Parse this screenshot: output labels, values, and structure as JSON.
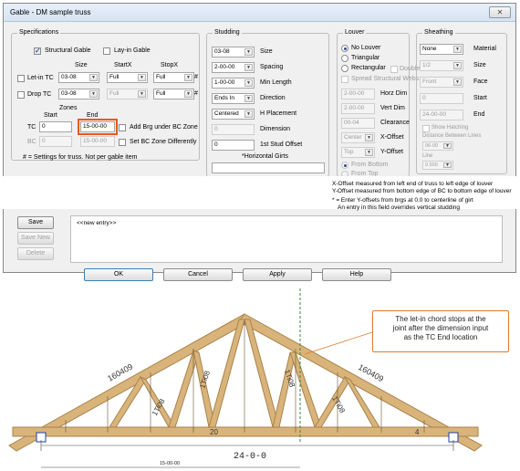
{
  "dialog": {
    "title": "Gable - DM sample truss",
    "close": "✕"
  },
  "specs": {
    "group": "Specifications",
    "structural_gable": "Structural Gable",
    "lay_in_gable": "Lay-in Gable",
    "col_size": "Size",
    "col_startx": "StartX",
    "col_stopx": "StopX",
    "letin_tc": "Let-in TC",
    "letin_size": "03-08",
    "letin_startx": "Full",
    "letin_stopx": "Full",
    "drop_tc": "Drop TC",
    "drop_size": "03-08",
    "drop_startx": "Full",
    "drop_stopx": "Full",
    "hash": "#",
    "zones": "Zones",
    "zones_start": "Start",
    "zones_end": "End",
    "tc": "TC",
    "tc_start": "0",
    "tc_end": "15-00-00",
    "bc": "BC",
    "bc_start": "0",
    "bc_end": "15-00-00",
    "add_brg": "Add Brg under BC Zone",
    "set_bc": "Set BC Zone Differently",
    "note": "# = Settings for truss.  Not per gable item"
  },
  "studding": {
    "group": "Studding",
    "size_val": "03-08",
    "size_lbl": "Size",
    "spacing_val": "2-00-00",
    "spacing_lbl": "Spacing",
    "minlen_val": "1-00-00",
    "minlen_lbl": "Min Length",
    "dir_val": "Ends In",
    "dir_lbl": "Direction",
    "hplace_val": "Centered",
    "hplace_lbl": "H Placement",
    "dim_val": "0",
    "dim_lbl": "Dimension",
    "first_val": "0",
    "first_lbl": "1st Stud Offset",
    "girts_lbl": "*Horizontal Girts",
    "girts_val": ""
  },
  "louver": {
    "group": "Louver",
    "no": "No Louver",
    "tri": "Triangular",
    "rect": "Rectangular",
    "double": "Double",
    "spread": "Spread Structural Webs",
    "horz_val": "2-00-00",
    "horz_lbl": "Horz Dim",
    "vert_val": "2-00-00",
    "vert_lbl": "Vert Dim",
    "clear_val": "00-04",
    "clear_lbl": "Clearance",
    "xoff_val": "Center",
    "xoff_lbl": "X-Offset",
    "yoff_val": "Top",
    "yoff_lbl": "Y-Offset",
    "from_bottom": "From Bottom",
    "from_top": "From Top"
  },
  "sheathing": {
    "group": "Sheathing",
    "mat_val": "None",
    "mat_lbl": "Material",
    "size_val": "1/2",
    "size_lbl": "Size",
    "face_val": "Front",
    "face_lbl": "Face",
    "start_val": "0",
    "start_lbl": "Start",
    "end_val": "24-00-00",
    "end_lbl": "End",
    "show_hatch": "Show Hatching",
    "dist_lbl": "Distance Between Lines",
    "dist_val": "06-00",
    "line_lbl": "Line",
    "line_val": "0.500"
  },
  "notes": {
    "x_off": "X-Offset measured from left end of truss to left edge of louver",
    "y_off": "Y-Offset measured from bottom edge of BC to bottom edge of louver",
    "enter1": "* = Enter Y-offsets from brgs at 0.0 to centerline of girt",
    "enter2": "An entry in this field overrides vertical studding"
  },
  "entries": {
    "save": "Save",
    "save_new": "Save New",
    "delete": "Delete",
    "new_entry": "<<new entry>>"
  },
  "footer": {
    "ok": "OK",
    "cancel": "Cancel",
    "apply": "Apply",
    "help": "Help"
  },
  "drawing": {
    "callout": [
      "The let-in chord stops at the",
      "joint after the dimension input",
      "as the TC End location"
    ],
    "span": "24-0-0",
    "sub_dim": "15-00-00",
    "member_labels": [
      "160409",
      "160409",
      "1Ti08",
      "1Ti08",
      "1Ti08",
      "1Ti08",
      "20",
      "4"
    ]
  },
  "colors": {
    "highlight": "#e8591c",
    "wood": "#c9a36b",
    "green": "#3a8a3a"
  }
}
